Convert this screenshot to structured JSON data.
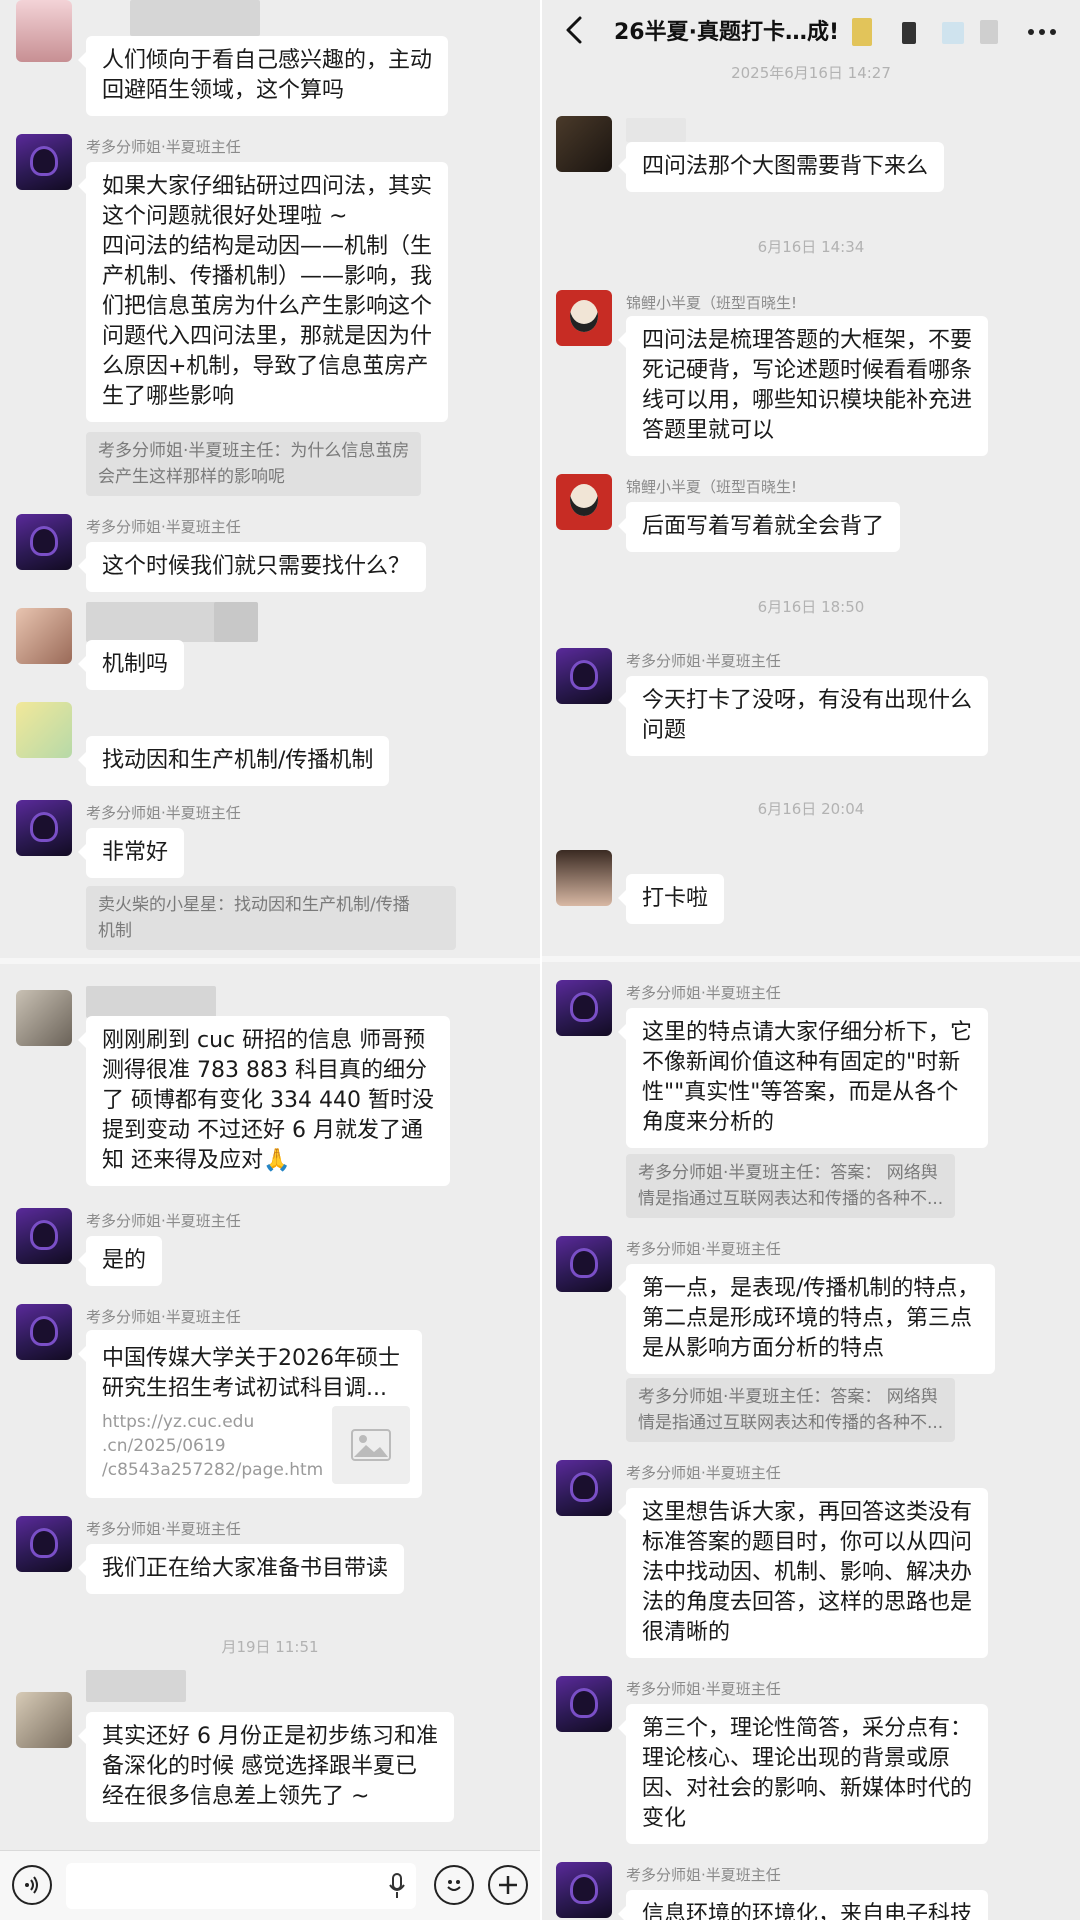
{
  "header": {
    "title": "26半夏·真题打卡…成!"
  },
  "names": {
    "teacher": "考多分师姐·半夏班主任",
    "jinli": "锦鲤小半夏（班型百晓生!"
  },
  "left": {
    "m1": "人们倾向于看自己感兴趣的，主动\n回避陌生领域，这个算吗",
    "m2": "如果大家仔细钻研过四问法，其实\n这个问题就很好处理啦 ~\n四问法的结构是动因——机制（生\n产机制、传播机制）——影响，我\n们把信息茧房为什么产生影响这个\n问题代入四问法里，那就是因为什\n么原因+机制，导致了信息茧房产\n生了哪些影响",
    "q2": "考多分师姐·半夏班主任：为什么信息茧房\n会产生这样那样的影响呢",
    "m3": "这个时候我们就只需要找什么？",
    "m4": "机制吗",
    "m5": "找动因和生产机制/传播机制",
    "m6": "非常好",
    "q6": "卖火柴的小星星：找动因和生产机制/传播\n机制",
    "m7": "刚刚刷到 cuc 研招的信息 师哥预\n测得很准 783 883 科目真的细分\n了 硕博都有变化 334 440 暂时没\n提到变动 不过还好 6 月就发了通\n知 还来得及应对🙏",
    "m8": "是的",
    "link_title": "中国传媒大学关于2026年硕士\n研究生招生考试初试科目调...",
    "link_url": "https://yz.cuc.edu\n.cn/2025/0619\n/c8543a257282/page.htm",
    "m10": "我们正在给大家准备书目带读",
    "t1": "月19日 11:51",
    "m11": "其实还好 6 月份正是初步练习和准\n备深化的时候 感觉选择跟半夏已\n经在很多信息差上领先了 ~"
  },
  "right": {
    "t0": "2025年6月16日 14:27",
    "r1": "四问法那个大图需要背下来么",
    "t1": "6月16日 14:34",
    "r2": "四问法是梳理答题的大框架，不要\n死记硬背，写论述题时候看看哪条\n线可以用，哪些知识模块能补充进\n答题里就可以",
    "r3": "后面写着写着就全会背了",
    "t2": "6月16日 18:50",
    "r4": "今天打卡了没呀，有没有出现什么\n问题",
    "t3": "6月16日 20:04",
    "r5": "打卡啦",
    "r6": "这里的特点请大家仔细分析下，它\n不像新闻价值这种有固定的\"时新\n性\"\"真实性\"等答案，而是从各个\n角度来分析的",
    "q6": "考多分师姐·半夏班主任：答案： 网络舆\n情是指通过互联网表达和传播的各种不...",
    "r7": "第一点，是表现/传播机制的特点，\n第二点是形成环境的特点，第三点\n是从影响方面分析的特点",
    "q7": "考多分师姐·半夏班主任：答案： 网络舆\n情是指通过互联网表达和传播的各种不...",
    "r8": "这里想告诉大家，再回答这类没有\n标准答案的题目时，你可以从四问\n法中找动因、机制、影响、解决办\n法的角度去回答，这样的思路也是\n很清晰的",
    "r9": "第三个，理论性简答，采分点有：\n理论核心、理论出现的背景或原\n因、对社会的影响、新媒体时代的\n变化",
    "r10": "信息环境的环境化，来自电子科技"
  },
  "colors": {
    "bg": "#ededed",
    "bubble": "#ffffff",
    "quote": "#e0e0e0",
    "meta": "#8a8a8a"
  },
  "icons": [
    "back-arrow-icon",
    "more-icon",
    "voice-icon",
    "mic-icon",
    "emoji-icon",
    "plus-icon",
    "image-placeholder-icon"
  ]
}
